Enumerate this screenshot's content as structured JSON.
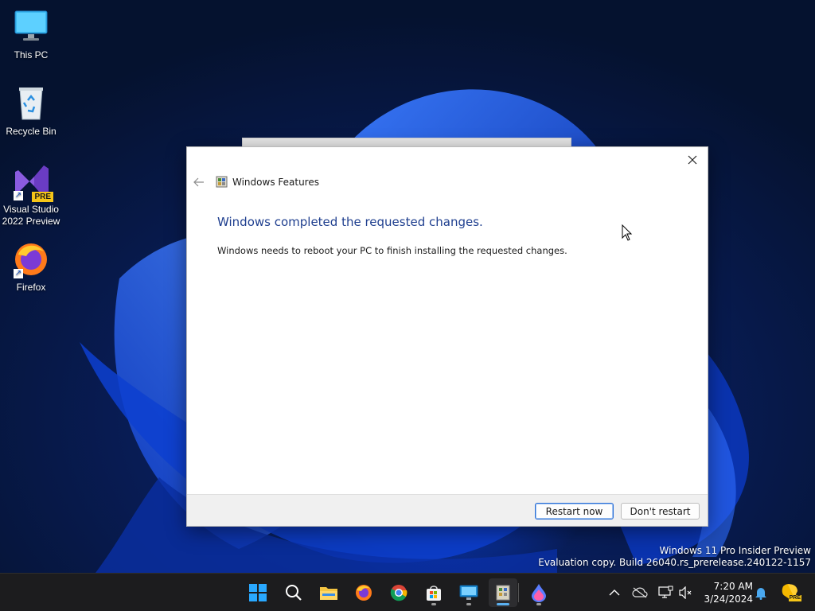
{
  "desktop": {
    "icons": [
      {
        "label": "This PC"
      },
      {
        "label": "Recycle Bin"
      },
      {
        "label": "Visual Studio 2022 Preview",
        "badge": "PRE"
      },
      {
        "label": "Firefox"
      }
    ]
  },
  "dialog": {
    "title": "Windows Features",
    "heading": "Windows completed the requested changes.",
    "message": "Windows needs to reboot your PC to finish installing the requested changes.",
    "restart_label": "Restart now",
    "dont_restart_label": "Don't restart",
    "accent_color": "#1f3f8f"
  },
  "watermark": {
    "line1": "Windows 11 Pro Insider Preview",
    "line2": "Evaluation copy. Build 26040.rs_prerelease.240122-1157"
  },
  "taskbar": {
    "apps": [
      "start-icon",
      "search-icon",
      "file-explorer-icon",
      "firefox-icon",
      "chrome-icon",
      "microsoft-store-icon",
      "remote-desktop-icon",
      "windows-features-icon",
      "firefox-nightly-icon"
    ],
    "tray_badge": "PRE",
    "time": "7:20 AM",
    "date": "3/24/2024"
  }
}
